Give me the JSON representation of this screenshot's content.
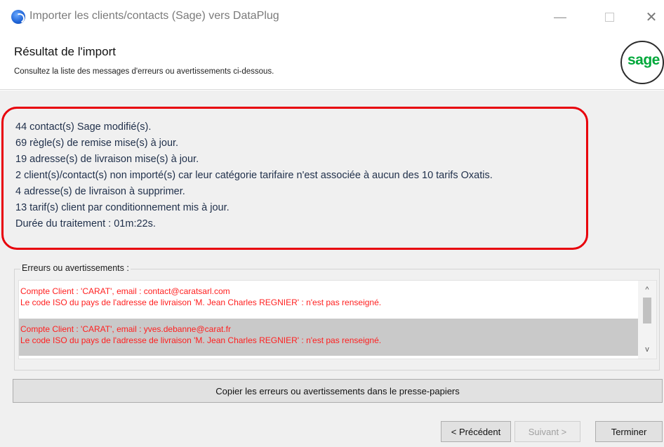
{
  "window": {
    "title": "Importer les clients/contacts (Sage) vers DataPlug",
    "minimize": "—",
    "close": "✕"
  },
  "header": {
    "title": "Résultat de l'import",
    "subtitle": "Consultez la liste des messages d'erreurs ou avertissements ci-dessous.",
    "logo": "sage"
  },
  "summary": [
    "44 contact(s) Sage modifié(s).",
    "69 règle(s) de remise mise(s) à jour.",
    "19 adresse(s) de livraison mise(s) à jour.",
    "2 client(s)/contact(s) non importé(s) car leur catégorie tarifaire n'est associée à aucun des 10 tarifs Oxatis.",
    "4 adresse(s) de livraison à supprimer.",
    "13 tarif(s) client par conditionnement mis à jour.",
    "Durée du traitement : 01m:22s."
  ],
  "errors_group": {
    "legend": "Erreurs ou avertissements :",
    "items": [
      {
        "line1": "Compte Client : 'CARAT', email : contact@caratsarl.com",
        "line2": "Le code ISO du pays de l'adresse de livraison 'M. Jean Charles REGNIER' : n'est pas renseigné."
      },
      {
        "line1": "Compte Client : 'CARAT', email : yves.debanne@carat.fr",
        "line2": "Le code ISO du pays de l'adresse de livraison 'M. Jean Charles REGNIER' : n'est pas renseigné."
      }
    ],
    "scroll_up": "^",
    "scroll_down": "v"
  },
  "buttons": {
    "copy": "Copier les erreurs ou avertissements dans le presse-papiers",
    "previous": "< Précédent",
    "next": "Suivant >",
    "finish": "Terminer"
  },
  "colors": {
    "highlight": "#e8000b",
    "error_text": "#ff1f1f",
    "sage_green": "#00a83a",
    "summary_text": "#1f2f4a"
  },
  "icons": [
    "app-icon",
    "minimize-icon",
    "maximize-icon",
    "close-icon",
    "scroll-up-icon",
    "scroll-down-icon"
  ]
}
